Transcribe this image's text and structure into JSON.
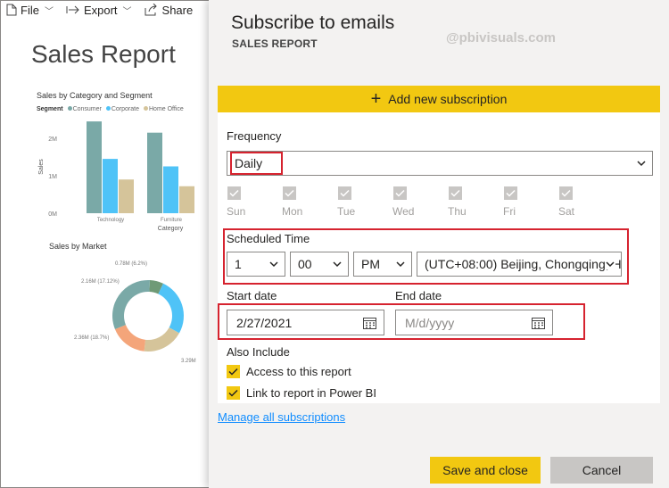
{
  "toolbar": {
    "file_label": "File",
    "export_label": "Export",
    "share_label": "Share"
  },
  "report": {
    "title": "Sales Report",
    "chart1_title": "Sales by Category and Segment",
    "legend_label": "Segment",
    "chart2_title": "Sales by Market"
  },
  "chart_data": [
    {
      "type": "bar",
      "title": "Sales by Category and Segment",
      "xlabel": "Category",
      "ylabel": "Sales",
      "categories": [
        "Technology",
        "Furniture"
      ],
      "yticks": [
        "2M",
        "1M",
        "0M"
      ],
      "ylim": [
        0,
        2.5
      ],
      "series": [
        {
          "name": "Consumer",
          "color": "#7aa9a7",
          "values": [
            2.45,
            2.15
          ]
        },
        {
          "name": "Corporate",
          "color": "#4fc3f7",
          "values": [
            1.45,
            1.25
          ]
        },
        {
          "name": "Home Office",
          "color": "#d5c49a",
          "values": [
            0.9,
            0.72
          ]
        }
      ]
    },
    {
      "type": "pie",
      "title": "Sales by Market",
      "slices": [
        {
          "value": 0.78,
          "color": "#6f9a76",
          "label": "0.78M (6.2%)"
        },
        {
          "value": 3.29,
          "color": "#4fc3f7",
          "label": "3.29M"
        },
        {
          "value": 2.36,
          "color": "#d5c49a",
          "label": "2.36M (18.7%)"
        },
        {
          "value": 2.16,
          "color": "#f4a57a",
          "label": "2.16M (17.12%)"
        },
        {
          "value": 4.03,
          "color": "#7aa9a7",
          "label": ""
        }
      ]
    }
  ],
  "dialog": {
    "title": "Subscribe to emails",
    "subtitle": "SALES REPORT",
    "watermark": "@pbivisuals.com",
    "add_label": "Add new subscription",
    "frequency_label": "Frequency",
    "frequency_value": "Daily",
    "days": [
      "Sun",
      "Mon",
      "Tue",
      "Wed",
      "Thu",
      "Fri",
      "Sat"
    ],
    "scheduled_label": "Scheduled Time",
    "hour": "1",
    "minute": "00",
    "ampm": "PM",
    "timezone": "(UTC+08:00) Beijing, Chongqing, H",
    "start_label": "Start date",
    "start_value": "2/27/2021",
    "end_label": "End date",
    "end_placeholder": "M/d/yyyy",
    "also_label": "Also Include",
    "access_label": "Access to this report",
    "link_label": "Link to report in Power BI",
    "manage_label": "Manage all subscriptions",
    "save_label": "Save and close",
    "cancel_label": "Cancel"
  }
}
